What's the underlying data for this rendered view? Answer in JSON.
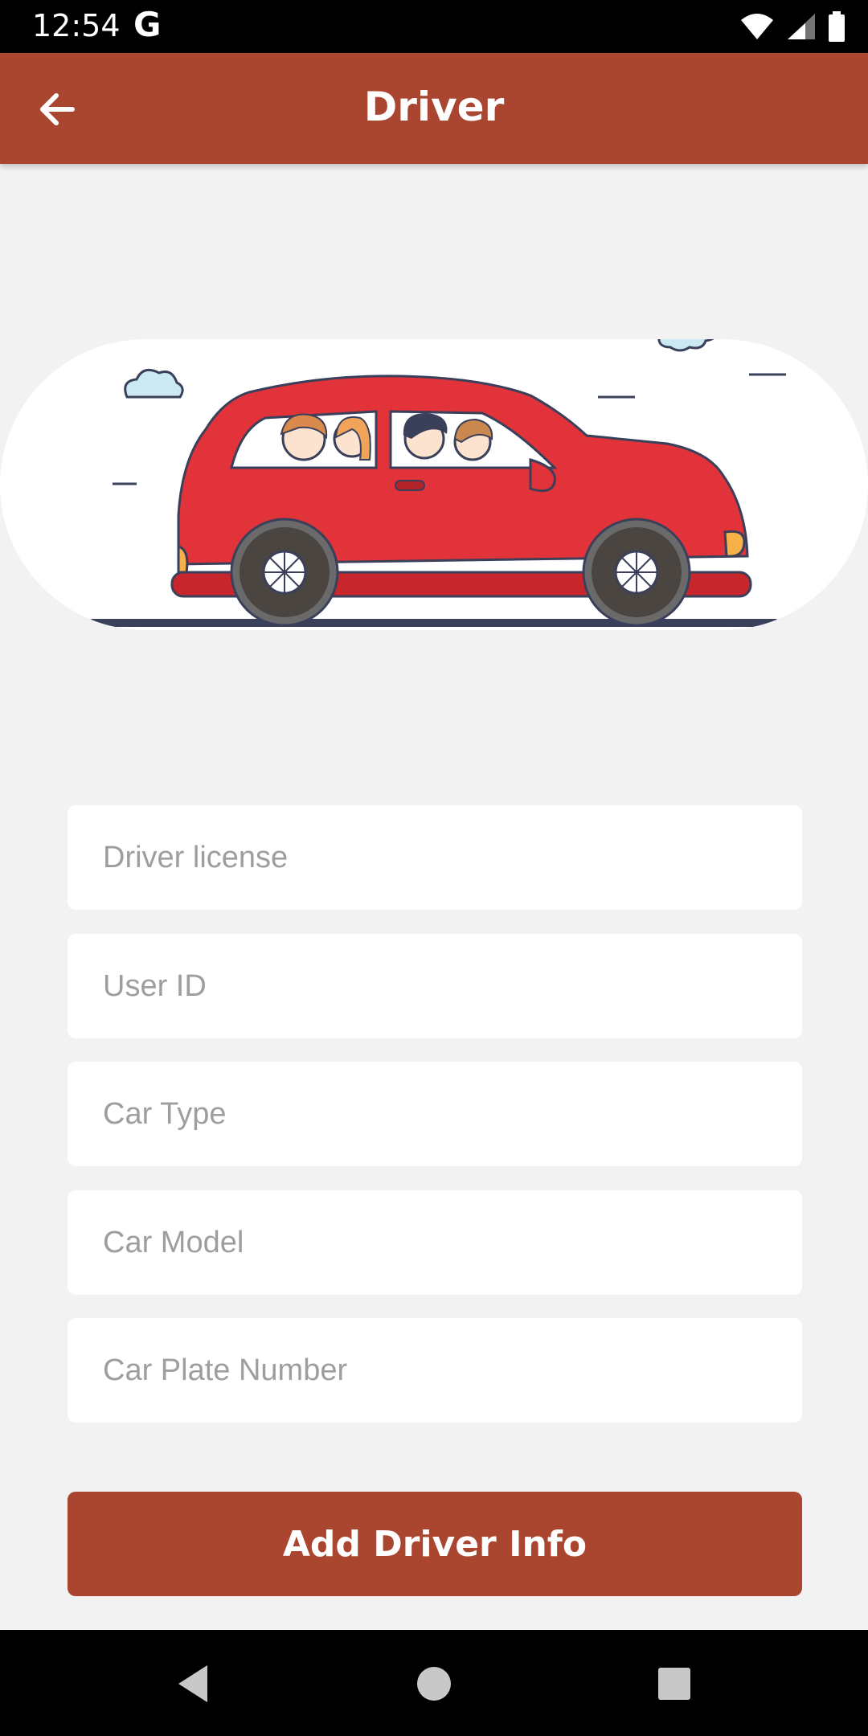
{
  "status_bar": {
    "time": "12:54",
    "notification": "G",
    "icons": [
      "wifi-icon",
      "signal-icon",
      "battery-icon"
    ]
  },
  "app_bar": {
    "title": "Driver",
    "back_icon": "arrow-left-icon",
    "color": "#aa4530"
  },
  "illustration": {
    "subject": "car-with-passengers"
  },
  "form": {
    "fields": [
      {
        "placeholder": "Driver license",
        "value": ""
      },
      {
        "placeholder": "User ID",
        "value": ""
      },
      {
        "placeholder": "Car Type",
        "value": ""
      },
      {
        "placeholder": "Car Model",
        "value": ""
      },
      {
        "placeholder": "Car Plate Number",
        "value": ""
      }
    ],
    "submit_label": "Add Driver Info"
  },
  "nav_bar": {
    "buttons": [
      "back-triangle-icon",
      "home-circle-icon",
      "recents-square-icon"
    ]
  }
}
